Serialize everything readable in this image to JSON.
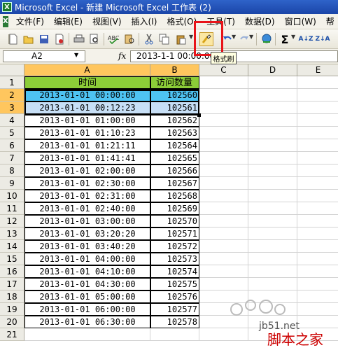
{
  "window": {
    "title": "Microsoft Excel - 新建 Microsoft Excel 工作表 (2)"
  },
  "menu": {
    "items": [
      {
        "id": "file",
        "label": "文件(F)"
      },
      {
        "id": "edit",
        "label": "编辑(E)"
      },
      {
        "id": "view",
        "label": "视图(V)"
      },
      {
        "id": "insert",
        "label": "插入(I)"
      },
      {
        "id": "format",
        "label": "格式(O)"
      },
      {
        "id": "tools",
        "label": "工具(T)"
      },
      {
        "id": "data",
        "label": "数据(D)"
      },
      {
        "id": "window",
        "label": "窗口(W)"
      },
      {
        "id": "help",
        "label": "帮"
      }
    ]
  },
  "toolbar": {
    "format_painter_tooltip": "格式刷",
    "sigma_label": "Σ",
    "sort_asc_label": "A↓Z",
    "sort_desc_label": "Z↓A"
  },
  "formula_bar": {
    "name_box": "A2",
    "fx_label": "fx",
    "content": "2013-1-1  00:00:00"
  },
  "grid": {
    "columns": [
      "A",
      "B",
      "C",
      "D",
      "E"
    ],
    "header_row": {
      "row": "1",
      "a": "时间",
      "b": "访问数量"
    },
    "rows": [
      {
        "row": "2",
        "a": "2013-01-01 00:00:00",
        "b": "102560"
      },
      {
        "row": "3",
        "a": "2013-01-01 00:12:23",
        "b": "102561"
      },
      {
        "row": "4",
        "a": "2013-01-01 01:00:00",
        "b": "102562"
      },
      {
        "row": "5",
        "a": "2013-01-01 01:10:23",
        "b": "102563"
      },
      {
        "row": "6",
        "a": "2013-01-01 01:21:11",
        "b": "102564"
      },
      {
        "row": "7",
        "a": "2013-01-01 01:41:41",
        "b": "102565"
      },
      {
        "row": "8",
        "a": "2013-01-01 02:00:00",
        "b": "102566"
      },
      {
        "row": "9",
        "a": "2013-01-01 02:30:00",
        "b": "102567"
      },
      {
        "row": "10",
        "a": "2013-01-01 02:31:00",
        "b": "102568"
      },
      {
        "row": "11",
        "a": "2013-01-01 02:40:00",
        "b": "102569"
      },
      {
        "row": "12",
        "a": "2013-01-01 03:00:00",
        "b": "102570"
      },
      {
        "row": "13",
        "a": "2013-01-01 03:20:20",
        "b": "102571"
      },
      {
        "row": "14",
        "a": "2013-01-01 03:40:20",
        "b": "102572"
      },
      {
        "row": "15",
        "a": "2013-01-01 04:00:00",
        "b": "102573"
      },
      {
        "row": "16",
        "a": "2013-01-01 04:10:00",
        "b": "102574"
      },
      {
        "row": "17",
        "a": "2013-01-01 04:30:00",
        "b": "102575"
      },
      {
        "row": "18",
        "a": "2013-01-01 05:00:00",
        "b": "102576"
      },
      {
        "row": "19",
        "a": "2013-01-01 06:00:00",
        "b": "102577"
      },
      {
        "row": "20",
        "a": "2013-01-01 06:30:00",
        "b": "102578"
      },
      {
        "row": "21",
        "a": "",
        "b": ""
      }
    ]
  },
  "watermark": {
    "site": "jb51.net",
    "brand": "脚本之家"
  },
  "colors": {
    "header_green": "#8ccd38",
    "selected_blue": "#4ec3f2",
    "selection_light_blue": "#c7dff6",
    "highlight_red": "#e8141a",
    "row_col_header_selected": "#ffc65e"
  }
}
